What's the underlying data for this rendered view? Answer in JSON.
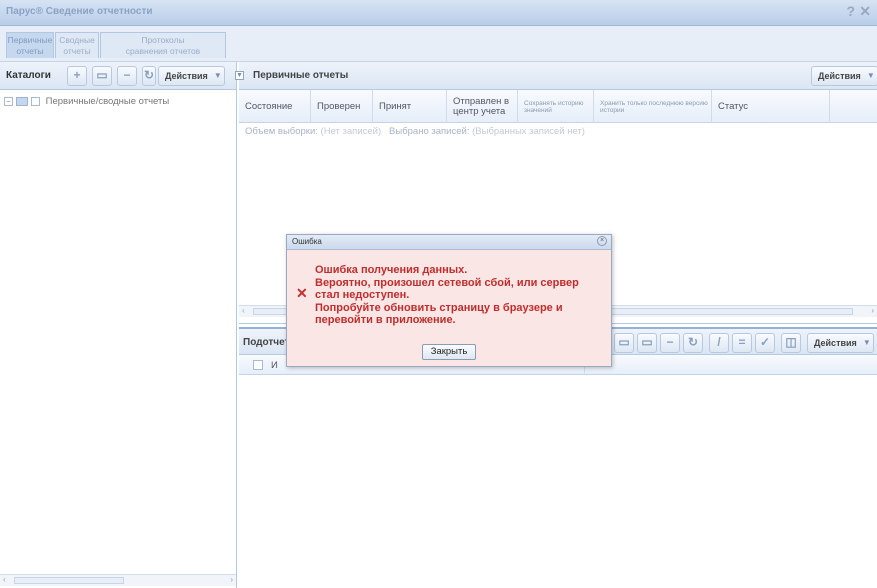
{
  "window": {
    "title": "Парус® Сведение отчетности",
    "help_glyph": "?",
    "close_glyph": "✕"
  },
  "top_tabs": [
    {
      "label_line1": "Первичные",
      "label_line2": "отчеты",
      "active": true
    },
    {
      "label_line1": "Сводные",
      "label_line2": "отчеты",
      "active": false
    },
    {
      "label_line1": "Протоколы",
      "label_line2": "сравнения отчетов",
      "active": false
    }
  ],
  "catalogs": {
    "title": "Каталоги",
    "actions_label": "Действия",
    "tree_root": "Первичные/сводные отчеты"
  },
  "primary_reports": {
    "title": "Первичные отчеты",
    "actions_label": "Действия",
    "columns": [
      "Состояние",
      "Проверен",
      "Принят",
      "Отправлен в центр учета",
      "Сохранять историю значений",
      "Хранить только последнюю версию истории",
      "Статус"
    ],
    "info": {
      "count_label": "Объем выборки:",
      "count_value": "(Нет записей)",
      "selected_label": "Выбрано записей:",
      "selected_value": "(Выбранных записей нет)"
    }
  },
  "lower_panel": {
    "title_fragment": "Подотчет",
    "column_fragment": "И",
    "actions_label": "Действия"
  },
  "dialog": {
    "title": "Ошибка",
    "message_lines": [
      "Ошибка получения данных.",
      "Вероятно, произошел сетевой сбой, или сервер",
      "стал недоступен.",
      "Попробуйте обновить страницу в браузере и",
      "перевойти в приложение."
    ],
    "close_button": "Закрыть"
  }
}
